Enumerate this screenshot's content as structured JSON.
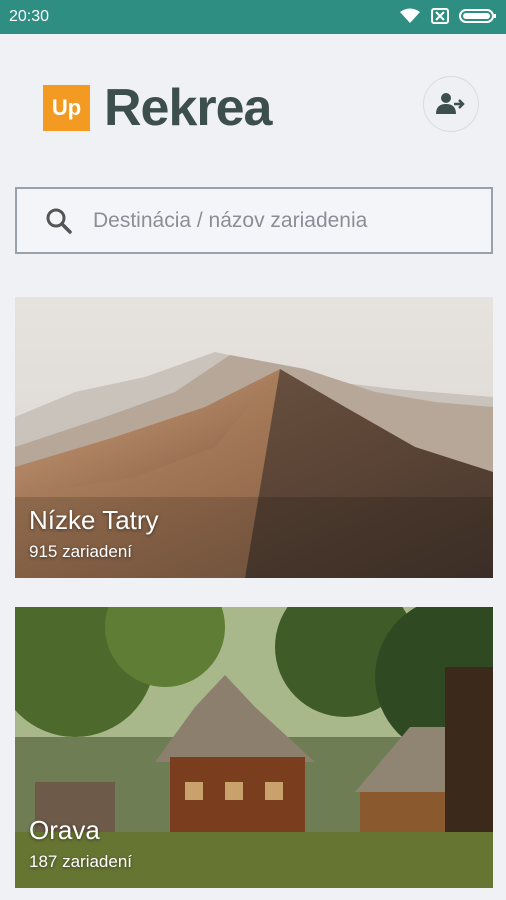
{
  "status_bar": {
    "time": "20:30",
    "icons": [
      "wifi-icon",
      "sim-icon",
      "battery-icon"
    ]
  },
  "brand": {
    "badge": "Up",
    "name": "Rekrea",
    "badge_color": "#f39a22",
    "text_color": "#3d4f4c"
  },
  "header": {
    "login_icon": "user-login-icon"
  },
  "search": {
    "placeholder": "Destinácia / názov zariadenia",
    "value": "",
    "icon": "search-icon"
  },
  "destinations": [
    {
      "name": "Nízke Tatry",
      "count": "915 zariadení",
      "image": "mountain-ridge-photo"
    },
    {
      "name": "Orava",
      "count": "187 zariadení",
      "image": "wooden-cottage-forest-photo"
    }
  ],
  "colors": {
    "status_bar": "#2f8e82",
    "background": "#f0f1f5"
  }
}
